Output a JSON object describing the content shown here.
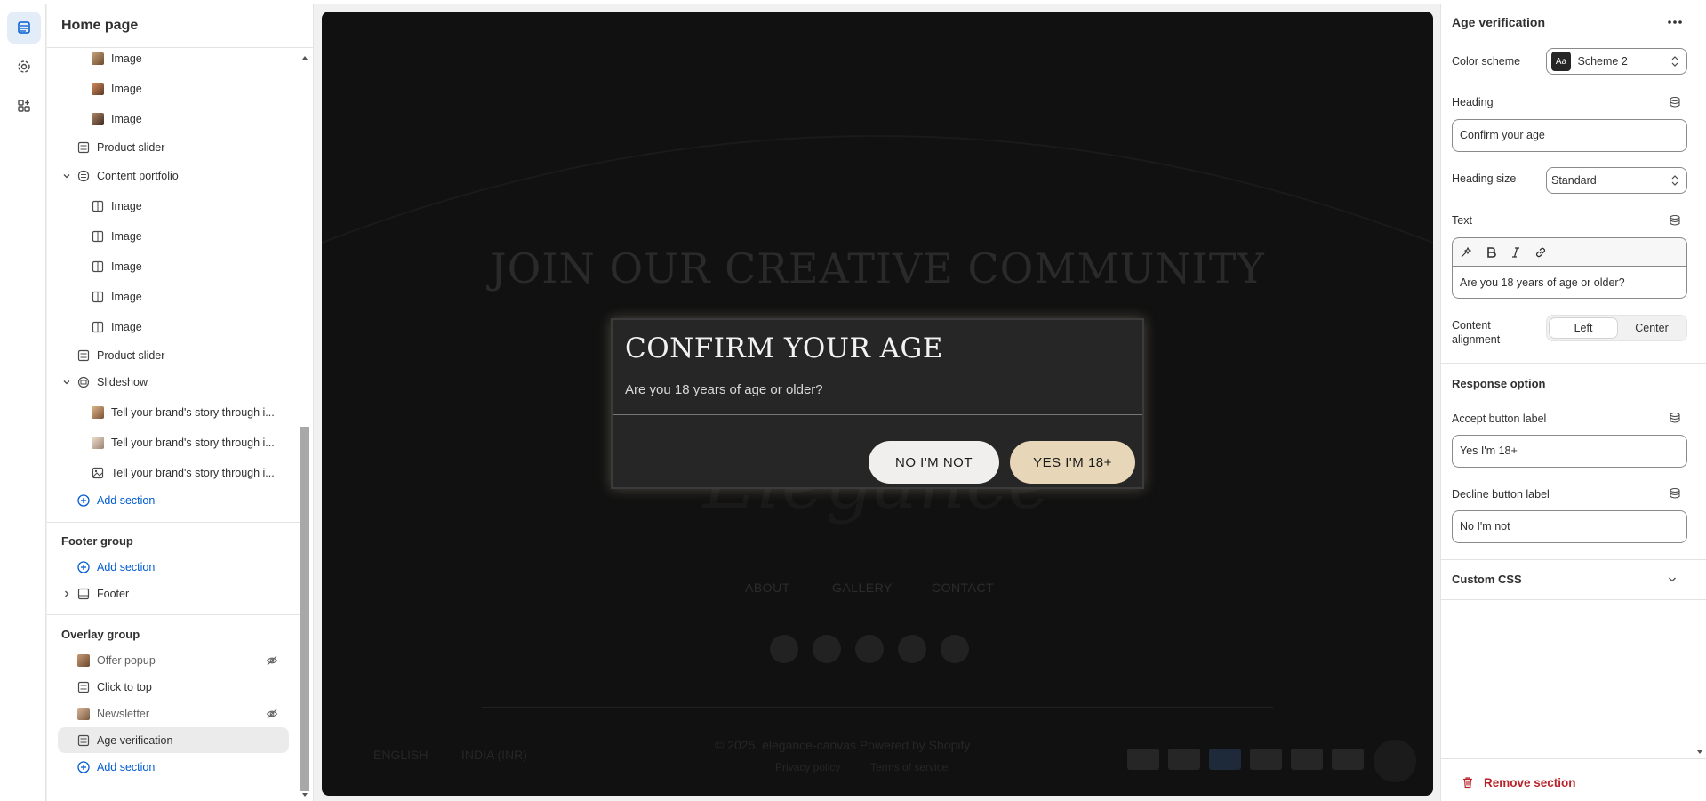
{
  "sidebar": {
    "title": "Home page",
    "items": [
      {
        "label": "Image"
      },
      {
        "label": "Image"
      },
      {
        "label": "Image"
      },
      {
        "label": "Product slider"
      },
      {
        "label": "Content portfolio"
      },
      {
        "label": "Image"
      },
      {
        "label": "Image"
      },
      {
        "label": "Image"
      },
      {
        "label": "Image"
      },
      {
        "label": "Image"
      },
      {
        "label": "Product slider"
      },
      {
        "label": "Slideshow"
      },
      {
        "label": "Tell your brand's story through i..."
      },
      {
        "label": "Tell your brand's story through i..."
      },
      {
        "label": "Tell your brand's story through i..."
      }
    ],
    "add_section": "Add section",
    "footer_group": {
      "title": "Footer group",
      "add_section": "Add section",
      "footer": "Footer"
    },
    "overlay_group": {
      "title": "Overlay group",
      "items": [
        {
          "label": "Offer popup"
        },
        {
          "label": "Click to top"
        },
        {
          "label": "Newsletter"
        },
        {
          "label": "Age verification"
        }
      ],
      "add_section": "Add section"
    }
  },
  "preview": {
    "bg_heading": "JOIN OUR CREATIVE COMMUNITY",
    "logo": "Elegance",
    "nav": [
      "ABOUT",
      "GALLERY",
      "CONTACT"
    ],
    "language": "ENGLISH",
    "currency": "INDIA (INR)",
    "copyright": "© 2025, elegance-canvas  Powered by Shopify",
    "policies": [
      "Privacy policy",
      "Terms of service"
    ],
    "payments": [
      "VISA",
      "MC",
      "AMEX",
      "PP",
      "DC",
      "DISCOVER"
    ],
    "modal": {
      "title": "CONFIRM YOUR AGE",
      "text": "Are you 18 years of age or older?",
      "decline": "NO I'M NOT",
      "accept": "YES I'M 18+"
    }
  },
  "settings": {
    "title": "Age verification",
    "color_scheme_label": "Color scheme",
    "color_scheme_value": "Scheme 2",
    "color_scheme_swatch": "Aa",
    "heading_label": "Heading",
    "heading_value": "Confirm your age",
    "heading_size_label": "Heading size",
    "heading_size_value": "Standard",
    "text_label": "Text",
    "text_value": "Are you 18 years of age or older?",
    "alignment_label": "Content alignment",
    "alignment_options": [
      "Left",
      "Center"
    ],
    "response_title": "Response option",
    "accept_label": "Accept button label",
    "accept_value": "Yes I'm 18+",
    "decline_label": "Decline button label",
    "decline_value": "No I'm not",
    "custom_css": "Custom CSS",
    "remove": "Remove section"
  },
  "colors": {
    "accent": "#005bd3",
    "danger": "#b8242b",
    "accept_btn": "#e7d7b8"
  }
}
